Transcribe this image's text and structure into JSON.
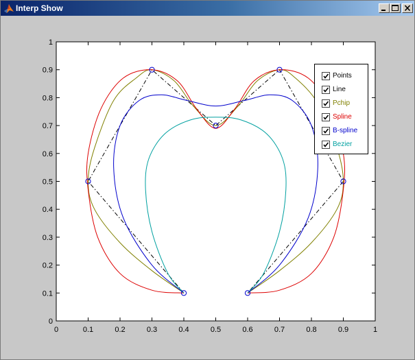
{
  "window": {
    "title": "Interp Show"
  },
  "title_buttons": {
    "minimize": "minimize",
    "maximize": "maximize",
    "close": "close"
  },
  "legend": {
    "items": [
      {
        "label": "Points",
        "checked": true,
        "color": "#000000"
      },
      {
        "label": "Line",
        "checked": true,
        "color": "#000000"
      },
      {
        "label": "Pchip",
        "checked": true,
        "color": "#808000"
      },
      {
        "label": "Spline",
        "checked": true,
        "color": "#dd0000"
      },
      {
        "label": "B-spline",
        "checked": true,
        "color": "#0000cc"
      },
      {
        "label": "Bezier",
        "checked": true,
        "color": "#00a0a0"
      }
    ]
  },
  "chart_data": {
    "type": "line",
    "title": "",
    "xlabel": "",
    "ylabel": "",
    "xlim": [
      0,
      1
    ],
    "ylim": [
      0,
      1
    ],
    "xticks": [
      "0",
      "0.1",
      "0.2",
      "0.3",
      "0.4",
      "0.5",
      "0.6",
      "0.7",
      "0.8",
      "0.9",
      "1"
    ],
    "yticks": [
      "0",
      "0.1",
      "0.2",
      "0.3",
      "0.4",
      "0.5",
      "0.6",
      "0.7",
      "0.8",
      "0.9",
      "1"
    ],
    "grid": false,
    "legend_position": "top-right",
    "series": [
      {
        "name": "Points",
        "style": "markers",
        "color": "#0000cc",
        "marker": "circle",
        "x": [
          0.4,
          0.1,
          0.3,
          0.5,
          0.7,
          0.9,
          0.6
        ],
        "y": [
          0.1,
          0.5,
          0.9,
          0.7,
          0.9,
          0.5,
          0.1
        ]
      },
      {
        "name": "Line",
        "style": "dashdot",
        "color": "#000000",
        "x": [
          0.4,
          0.1,
          0.3,
          0.5,
          0.7,
          0.9,
          0.6
        ],
        "y": [
          0.1,
          0.5,
          0.9,
          0.7,
          0.9,
          0.5,
          0.1
        ]
      },
      {
        "name": "Pchip",
        "style": "solid",
        "color": "#808000",
        "x": [
          0.4,
          0.3,
          0.2,
          0.12,
          0.1,
          0.12,
          0.18,
          0.25,
          0.3,
          0.37,
          0.43,
          0.5,
          0.57,
          0.63,
          0.7,
          0.75,
          0.82,
          0.88,
          0.9,
          0.88,
          0.8,
          0.7,
          0.6
        ],
        "y": [
          0.1,
          0.18,
          0.28,
          0.4,
          0.5,
          0.62,
          0.79,
          0.87,
          0.9,
          0.86,
          0.77,
          0.7,
          0.77,
          0.86,
          0.9,
          0.87,
          0.78,
          0.62,
          0.5,
          0.4,
          0.28,
          0.18,
          0.1
        ]
      },
      {
        "name": "Spline",
        "style": "solid",
        "color": "#dd0000",
        "x": [
          0.4,
          0.3,
          0.2,
          0.13,
          0.1,
          0.1,
          0.14,
          0.21,
          0.3,
          0.38,
          0.44,
          0.5,
          0.56,
          0.62,
          0.7,
          0.79,
          0.86,
          0.9,
          0.9,
          0.87,
          0.8,
          0.7,
          0.6
        ],
        "y": [
          0.1,
          0.11,
          0.17,
          0.3,
          0.47,
          0.6,
          0.76,
          0.87,
          0.9,
          0.86,
          0.76,
          0.69,
          0.76,
          0.86,
          0.9,
          0.87,
          0.76,
          0.6,
          0.47,
          0.3,
          0.17,
          0.11,
          0.1
        ]
      },
      {
        "name": "B-spline",
        "style": "solid",
        "color": "#0000cc",
        "x": [
          0.4,
          0.3,
          0.21,
          0.18,
          0.2,
          0.26,
          0.33,
          0.41,
          0.5,
          0.59,
          0.67,
          0.74,
          0.8,
          0.82,
          0.79,
          0.7,
          0.6
        ],
        "y": [
          0.1,
          0.2,
          0.37,
          0.55,
          0.7,
          0.79,
          0.81,
          0.79,
          0.77,
          0.79,
          0.81,
          0.79,
          0.7,
          0.55,
          0.37,
          0.2,
          0.1
        ]
      },
      {
        "name": "Bezier",
        "style": "solid",
        "color": "#00a0a0",
        "x": [
          0.4,
          0.35,
          0.3,
          0.28,
          0.29,
          0.34,
          0.42,
          0.5,
          0.58,
          0.66,
          0.71,
          0.72,
          0.7,
          0.65,
          0.6
        ],
        "y": [
          0.1,
          0.17,
          0.32,
          0.47,
          0.58,
          0.67,
          0.72,
          0.73,
          0.72,
          0.67,
          0.58,
          0.47,
          0.32,
          0.17,
          0.1
        ]
      }
    ]
  }
}
